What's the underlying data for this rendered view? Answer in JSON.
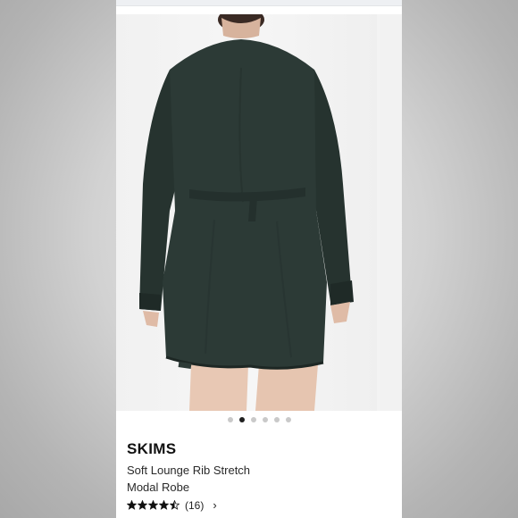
{
  "product": {
    "brand": "SKIMS",
    "title_line1": "Soft Lounge Rib Stretch",
    "title_line2": "Modal Robe",
    "rating_value": 4.5,
    "review_count": "(16)",
    "chevron": "›"
  },
  "gallery": {
    "slide_count": 6,
    "active_index": 1,
    "garment_color": "#2c3a36"
  },
  "icons": {
    "star": "star-icon",
    "chevron": "chevron-right-icon"
  }
}
